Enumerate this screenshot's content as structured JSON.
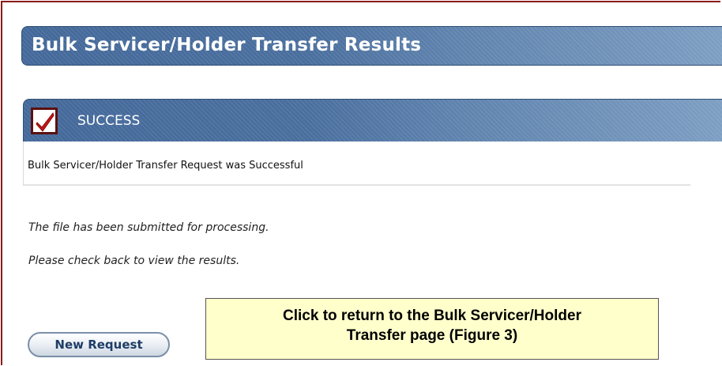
{
  "page": {
    "title": "Bulk Servicer/Holder Transfer Results"
  },
  "success": {
    "label": "SUCCESS",
    "icon": "checkmark-icon",
    "message": "Bulk Servicer/Holder Transfer Request was Successful"
  },
  "info": {
    "line1": "The file has been submitted for processing.",
    "line2": "Please check back to view the results."
  },
  "actions": {
    "new_request_label": "New Request"
  },
  "callout": {
    "line1": "Click to return to the Bulk Servicer/Holder",
    "line2": "Transfer page (Figure 3)"
  },
  "colors": {
    "header_blue": "#3e6491",
    "frame_red": "#8b1a1a",
    "callout_bg": "#ffffcc",
    "check_red": "#c01818"
  }
}
